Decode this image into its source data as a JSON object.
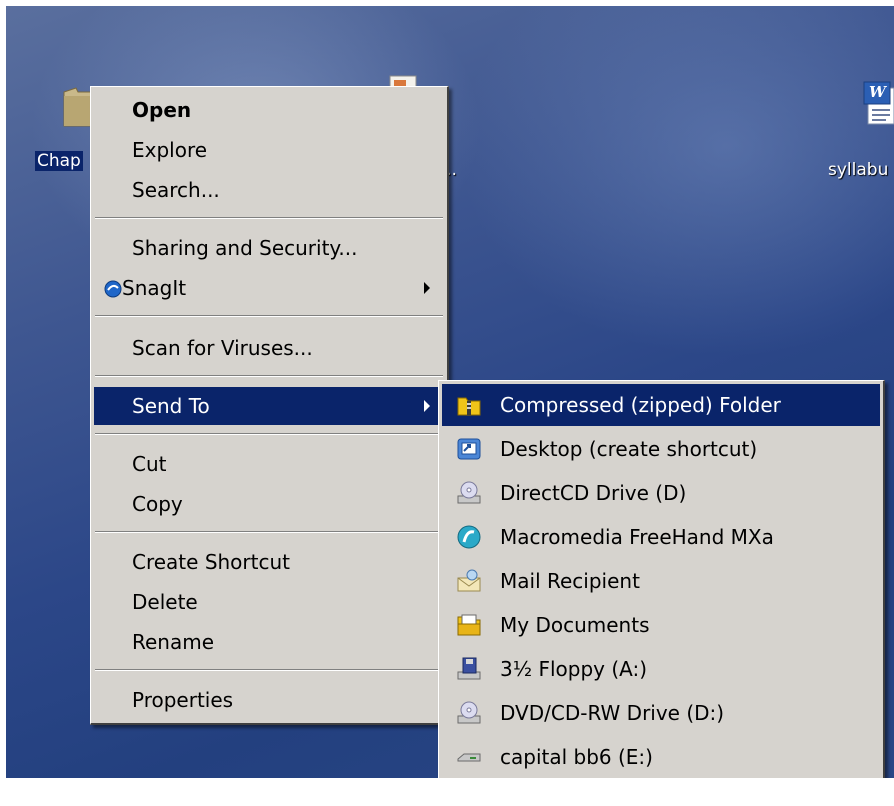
{
  "desktop": {
    "icons": [
      {
        "label": "Chap",
        "icon": "folder-icon",
        "selected": true
      },
      {
        "label": "l...",
        "icon": "document-icon",
        "selected": false
      },
      {
        "label": "syllabu",
        "icon": "word-document-icon",
        "selected": false
      }
    ],
    "word_icon_letter": "W"
  },
  "context_menu": {
    "items": [
      {
        "label": "Open",
        "bold": true
      },
      {
        "label": "Explore"
      },
      {
        "label": "Search..."
      },
      {
        "label": "Sharing and Security..."
      },
      {
        "label": "SnagIt",
        "icon": "snagit-icon",
        "submenu": true
      },
      {
        "label": "Scan for Viruses..."
      },
      {
        "label": "Send To",
        "submenu": true,
        "highlighted": true
      },
      {
        "label": "Cut"
      },
      {
        "label": "Copy"
      },
      {
        "label": "Create Shortcut"
      },
      {
        "label": "Delete"
      },
      {
        "label": "Rename"
      },
      {
        "label": "Properties"
      }
    ]
  },
  "send_to_menu": {
    "items": [
      {
        "label": "Compressed (zipped) Folder",
        "icon": "zip-folder-icon",
        "highlighted": true
      },
      {
        "label": "Desktop (create shortcut)",
        "icon": "desktop-shortcut-icon"
      },
      {
        "label": "DirectCD Drive (D)",
        "icon": "cd-drive-icon"
      },
      {
        "label": "Macromedia FreeHand MXa",
        "icon": "freehand-icon"
      },
      {
        "label": "Mail Recipient",
        "icon": "mail-recipient-icon"
      },
      {
        "label": "My Documents",
        "icon": "my-documents-icon"
      },
      {
        "label": "3½ Floppy (A:)",
        "icon": "floppy-drive-icon"
      },
      {
        "label": "DVD/CD-RW Drive (D:)",
        "icon": "dvd-drive-icon"
      },
      {
        "label": "capital bb6 (E:)",
        "icon": "removable-drive-icon"
      }
    ]
  },
  "colors": {
    "highlight": "#0a246a",
    "menu_bg": "#d6d3ce",
    "desktop_bg": "#2c4788"
  }
}
